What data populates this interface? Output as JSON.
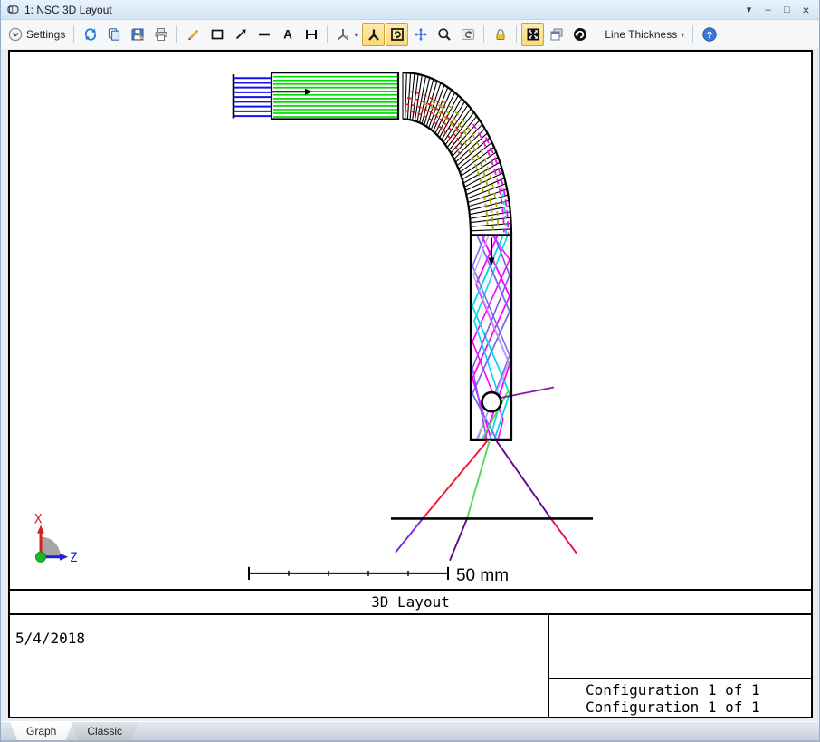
{
  "titlebar": {
    "title": "1: NSC 3D Layout",
    "controls": {
      "menu": "▾",
      "minimize": "–",
      "maximize": "□",
      "close": "×"
    }
  },
  "toolbar": {
    "settings_label": "Settings",
    "line_thickness_label": "Line Thickness",
    "orientation_caret": "▾",
    "line_thickness_caret": "▾"
  },
  "canvas": {
    "scale_label": "50 mm",
    "axis_x_label": "X",
    "axis_z_label": "Z",
    "colors": {
      "outline": "#000000",
      "source_rays": "#1414e8",
      "pipe_rays": "#00dc00",
      "bend_red": "#e81414",
      "bend_olive": "#a8a800",
      "bend_magenta": "#ff00ff",
      "bend_cyan": "#00dcec",
      "pipe_magenta": "#ff00ff",
      "pipe_cyan": "#00d8f0",
      "pipe_slate": "#7070ee",
      "pipe_lavender": "#b8a8f8",
      "pipe_violet": "#8a50f0",
      "exit_red": "#f01830",
      "exit_violet": "#7a28e2",
      "exit_green": "#58d858",
      "exit_darkpurple": "#600890",
      "exit_crimson": "#e81448",
      "purple_stray": "#8818a8",
      "axis_x": "#d42020",
      "axis_z": "#2020d4",
      "axis_origin": "#20b820"
    }
  },
  "plot_info": {
    "title": "3D Layout",
    "date": "5/4/2018",
    "config_line_1": "Configuration 1 of 1",
    "config_line_2": "Configuration 1 of 1"
  },
  "tabs": [
    {
      "label": "Graph"
    },
    {
      "label": "Classic"
    }
  ]
}
